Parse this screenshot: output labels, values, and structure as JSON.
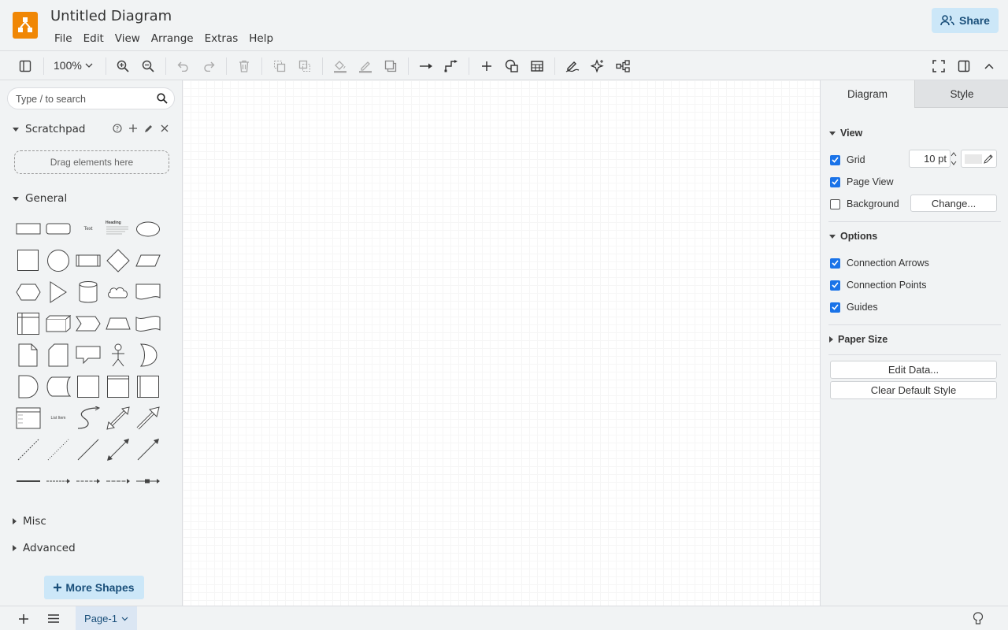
{
  "app": {
    "title": "Untitled Diagram",
    "brand_color": "#f08705",
    "logo": "drawio-logo-icon"
  },
  "menu": [
    "File",
    "Edit",
    "View",
    "Arrange",
    "Extras",
    "Help"
  ],
  "share_label": "Share",
  "toolbar": {
    "zoom": "100%",
    "icons": [
      "format-panel-toggle-icon",
      "zoom-in-icon",
      "zoom-out-icon",
      "undo-icon",
      "redo-icon",
      "delete-icon",
      "to-front-icon",
      "to-back-icon",
      "fill-color-icon",
      "line-color-icon",
      "shadow-icon",
      "connection-icon",
      "waypoints-icon",
      "insert-icon",
      "shapes-icon",
      "table-icon",
      "freehand-icon",
      "generate-icon",
      "layout-icon",
      "fullscreen-icon",
      "toggle-format-icon",
      "collapse-icon"
    ]
  },
  "left": {
    "search_placeholder": "Type / to search",
    "scratchpad_label": "Scratchpad",
    "dropzone_label": "Drag elements here",
    "general_label": "General",
    "misc_label": "Misc",
    "advanced_label": "Advanced",
    "more_shapes_label": "More Shapes",
    "shape_text_label": "Text",
    "shape_heading_label": "Heading",
    "shape_list_item_label": "List Item"
  },
  "right": {
    "tab_diagram": "Diagram",
    "tab_style": "Style",
    "view_label": "View",
    "grid_label": "Grid",
    "grid_size": "10 pt",
    "page_view_label": "Page View",
    "background_label": "Background",
    "change_label": "Change...",
    "options_label": "Options",
    "connection_arrows_label": "Connection Arrows",
    "connection_points_label": "Connection Points",
    "guides_label": "Guides",
    "paper_size_label": "Paper Size",
    "edit_data_label": "Edit Data...",
    "clear_style_label": "Clear Default Style",
    "grid_checked": true,
    "page_view_checked": true,
    "background_checked": false,
    "connection_arrows_checked": true,
    "connection_points_checked": true,
    "guides_checked": true
  },
  "bottom": {
    "page_tab": "Page-1"
  }
}
